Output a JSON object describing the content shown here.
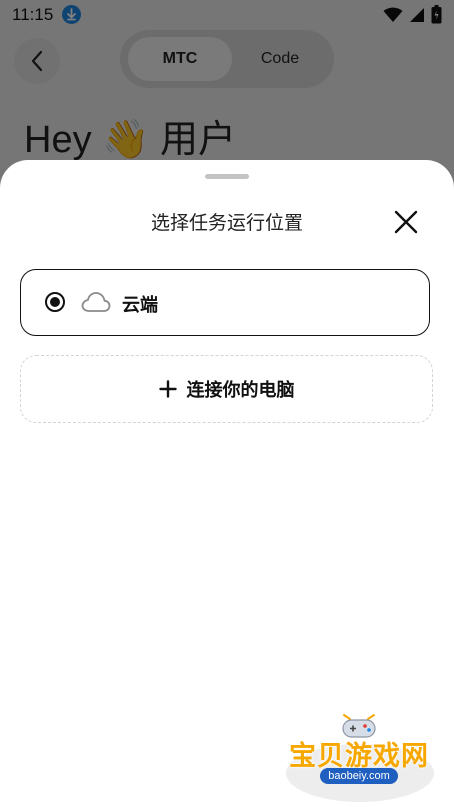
{
  "status_bar": {
    "time": "11:15"
  },
  "header": {
    "tabs": [
      {
        "label": "MTC"
      },
      {
        "label": "Code"
      }
    ],
    "greeting": "Hey 👋 用户"
  },
  "sheet": {
    "title": "选择任务运行位置",
    "options": [
      {
        "label": "云端",
        "selected": true
      },
      {
        "label": "连接你的电脑"
      }
    ]
  },
  "watermark": {
    "brand": "宝贝游戏网",
    "url": "baobeiy.com"
  },
  "colors": {
    "scrim": "#000000",
    "watermark_orange": "#f7a800",
    "watermark_blue": "#1f5fbf"
  }
}
